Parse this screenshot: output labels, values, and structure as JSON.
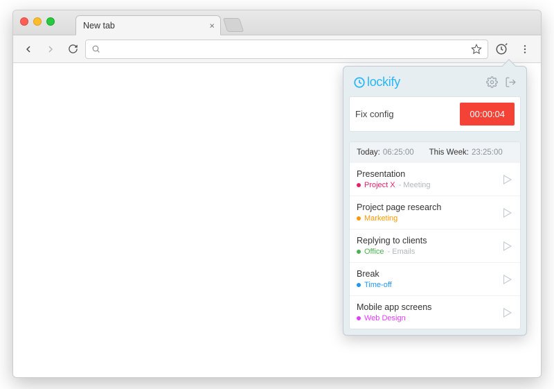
{
  "window": {
    "tab_title": "New tab"
  },
  "popover": {
    "brand": "lockify",
    "timer": {
      "description": "Fix config",
      "elapsed": "00:00:04"
    },
    "summary": {
      "today_label": "Today:",
      "today_value": "06:25:00",
      "week_label": "This Week:",
      "week_value": "23:25:00"
    },
    "entries": [
      {
        "title": "Presentation",
        "project": "Project X",
        "project_color": "#e91e63",
        "extra": "Meeting"
      },
      {
        "title": "Project page research",
        "project": "Marketing",
        "project_color": "#ff9800",
        "extra": ""
      },
      {
        "title": "Replying to clients",
        "project": "Office",
        "project_color": "#4caf50",
        "extra": "Emails"
      },
      {
        "title": "Break",
        "project": "Time-off",
        "project_color": "#2196f3",
        "extra": ""
      },
      {
        "title": "Mobile app screens",
        "project": "Web Design",
        "project_color": "#e040fb",
        "extra": ""
      }
    ]
  }
}
